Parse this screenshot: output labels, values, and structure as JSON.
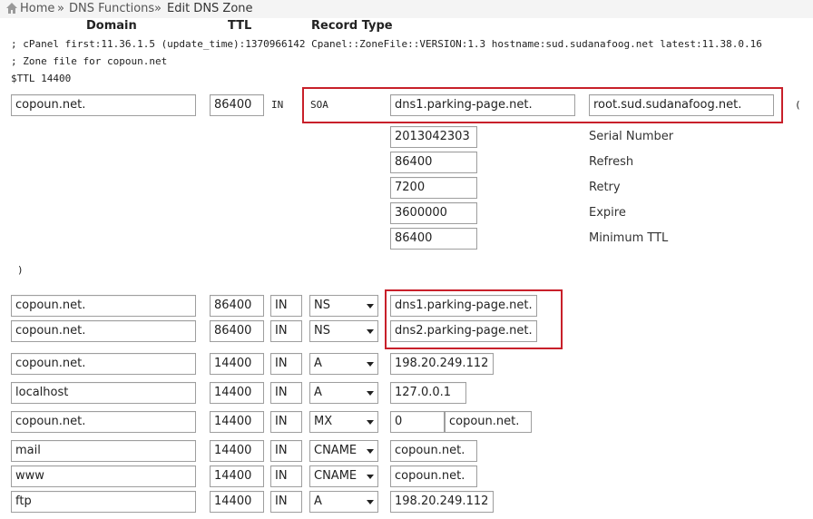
{
  "breadcrumb": {
    "home": "Home",
    "sep": "»",
    "dns_functions": "DNS Functions",
    "current": "Edit DNS Zone"
  },
  "columns": {
    "domain": "Domain",
    "ttl": "TTL",
    "record_type": "Record Type"
  },
  "header_lines": [
    "; cPanel first:11.36.1.5 (update_time):1370966142 Cpanel::ZoneFile::VERSION:1.3 hostname:sud.sudanafoog.net latest:11.38.0.16",
    "; Zone file for copoun.net",
    "$TTL 14400"
  ],
  "soa": {
    "domain": "copoun.net.",
    "ttl": "86400",
    "class": "IN",
    "type": "SOA",
    "mname": "dns1.parking-page.net.",
    "rname": "root.sud.sudanafoog.net.",
    "open_paren": "(",
    "close_paren": ")",
    "params": [
      {
        "value": "2013042303",
        "label": "Serial Number"
      },
      {
        "value": "86400",
        "label": "Refresh"
      },
      {
        "value": "7200",
        "label": "Retry"
      },
      {
        "value": "3600000",
        "label": "Expire"
      },
      {
        "value": "86400",
        "label": "Minimum TTL"
      }
    ]
  },
  "records": [
    {
      "domain": "copoun.net.",
      "ttl": "86400",
      "class": "IN",
      "type": "NS",
      "value": "dns1.parking-page.net."
    },
    {
      "domain": "copoun.net.",
      "ttl": "86400",
      "class": "IN",
      "type": "NS",
      "value": "dns2.parking-page.net."
    },
    {
      "domain": "copoun.net.",
      "ttl": "14400",
      "class": "IN",
      "type": "A",
      "value": "198.20.249.112"
    },
    {
      "domain": "localhost",
      "ttl": "14400",
      "class": "IN",
      "type": "A",
      "value": "127.0.0.1"
    },
    {
      "domain": "copoun.net.",
      "ttl": "14400",
      "class": "IN",
      "type": "MX",
      "priority": "0",
      "value": "copoun.net."
    },
    {
      "domain": "mail",
      "ttl": "14400",
      "class": "IN",
      "type": "CNAME",
      "value": "copoun.net."
    },
    {
      "domain": "www",
      "ttl": "14400",
      "class": "IN",
      "type": "CNAME",
      "value": "copoun.net."
    },
    {
      "domain": "ftp",
      "ttl": "14400",
      "class": "IN",
      "type": "A",
      "value": "198.20.249.112"
    }
  ],
  "colors": {
    "highlight": "#c8202a"
  }
}
